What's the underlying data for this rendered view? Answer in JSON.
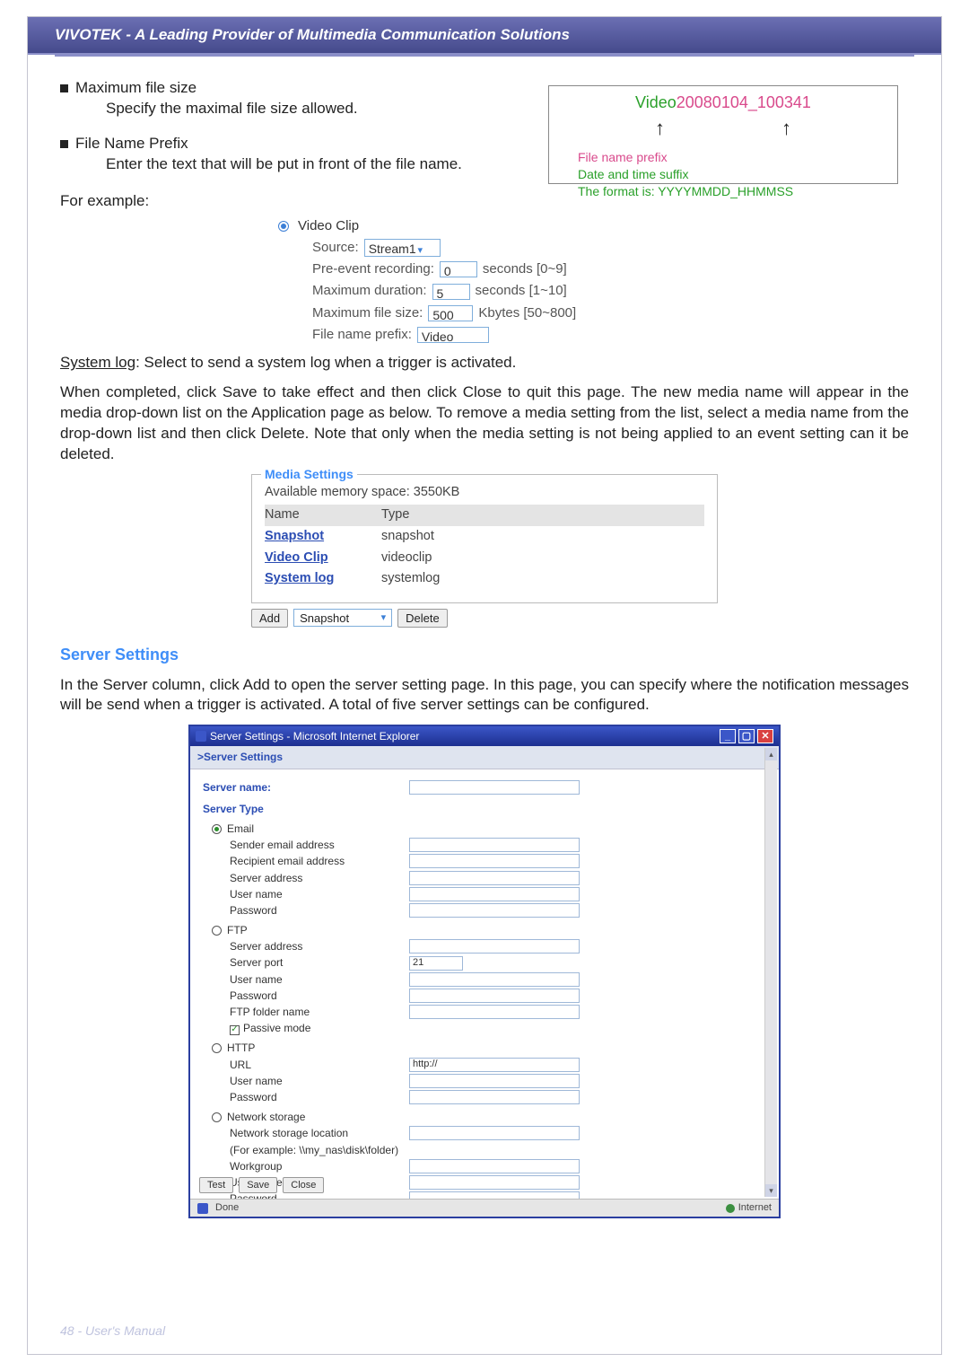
{
  "header": {
    "title": "VIVOTEK - A Leading Provider of Multimedia Communication Solutions"
  },
  "bullets": {
    "max_fs_title": "Maximum file size",
    "max_fs_desc": "Specify the maximal file size allowed.",
    "prefix_title": "File Name Prefix",
    "prefix_desc": "Enter the text that will be put in front of the file name."
  },
  "example_label": "For example:",
  "filename_box": {
    "prefix": "Video",
    "datetime": "20080104_100341",
    "prefix_caption": "File name prefix",
    "suffix_caption1": "Date and time suffix",
    "suffix_caption2": "The format is: YYYYMMDD_HHMMSS"
  },
  "video_clip": {
    "legend": "Video Clip",
    "source_label": "Source:",
    "source_value": "Stream1",
    "pre_label": "Pre-event recording:",
    "pre_value": "0",
    "pre_range": "seconds [0~9]",
    "maxdur_label": "Maximum duration:",
    "maxdur_value": "5",
    "maxdur_range": "seconds [1~10]",
    "maxfs_label": "Maximum file size:",
    "maxfs_value": "500",
    "maxfs_range": "Kbytes [50~800]",
    "prefix_label": "File name prefix:",
    "prefix_value": "Video"
  },
  "syslog_para": {
    "label": "System log",
    "rest": ": Select to send a system log when a trigger is activated."
  },
  "completed_para": "When completed, click Save to take effect and then click Close to quit this page. The new media name will appear in the media drop-down list on the Application page as below. To remove a media setting from the list, select a media name from the drop-down list and then click Delete. Note that only when the media setting is not being applied to an event setting can it be deleted.",
  "media_settings": {
    "legend": "Media Settings",
    "memline": "Available memory space: 3550KB",
    "hdr_name": "Name",
    "hdr_type": "Type",
    "rows": [
      {
        "name": "Snapshot",
        "type": "snapshot"
      },
      {
        "name": "Video Clip",
        "type": "videoclip"
      },
      {
        "name": "System log",
        "type": "systemlog"
      }
    ],
    "add": "Add",
    "selected": "Snapshot",
    "delete": "Delete"
  },
  "server": {
    "heading": "Server Settings",
    "para": "In the Server column, click Add to open the server setting page. In this page, you can specify where the notification messages will be send when a trigger is activated. A total of five server settings can be configured."
  },
  "iewin": {
    "title": "Server Settings - Microsoft Internet Explorer",
    "subtitle": ">Server Settings",
    "server_name_label": "Server name:",
    "server_type_label": "Server Type",
    "email": {
      "opt": "Email",
      "sender": "Sender email address",
      "recipient": "Recipient email address",
      "server": "Server address",
      "user": "User name",
      "pass": "Password"
    },
    "ftp": {
      "opt": "FTP",
      "server": "Server address",
      "port_label": "Server port",
      "port_value": "21",
      "user": "User name",
      "pass": "Password",
      "folder": "FTP folder name",
      "passive": "Passive mode"
    },
    "http": {
      "opt": "HTTP",
      "url_label": "URL",
      "url_value": "http://",
      "user": "User name",
      "pass": "Password"
    },
    "ns": {
      "opt": "Network storage",
      "loc": "Network storage location",
      "example": "(For example: \\\\my_nas\\disk\\folder)",
      "wg": "Workgroup",
      "user": "User name",
      "pass": "Password"
    },
    "btn_test": "Test",
    "btn_save": "Save",
    "btn_close": "Close",
    "status_done": "Done",
    "status_zone": "Internet"
  },
  "footer": "48 - User's Manual"
}
